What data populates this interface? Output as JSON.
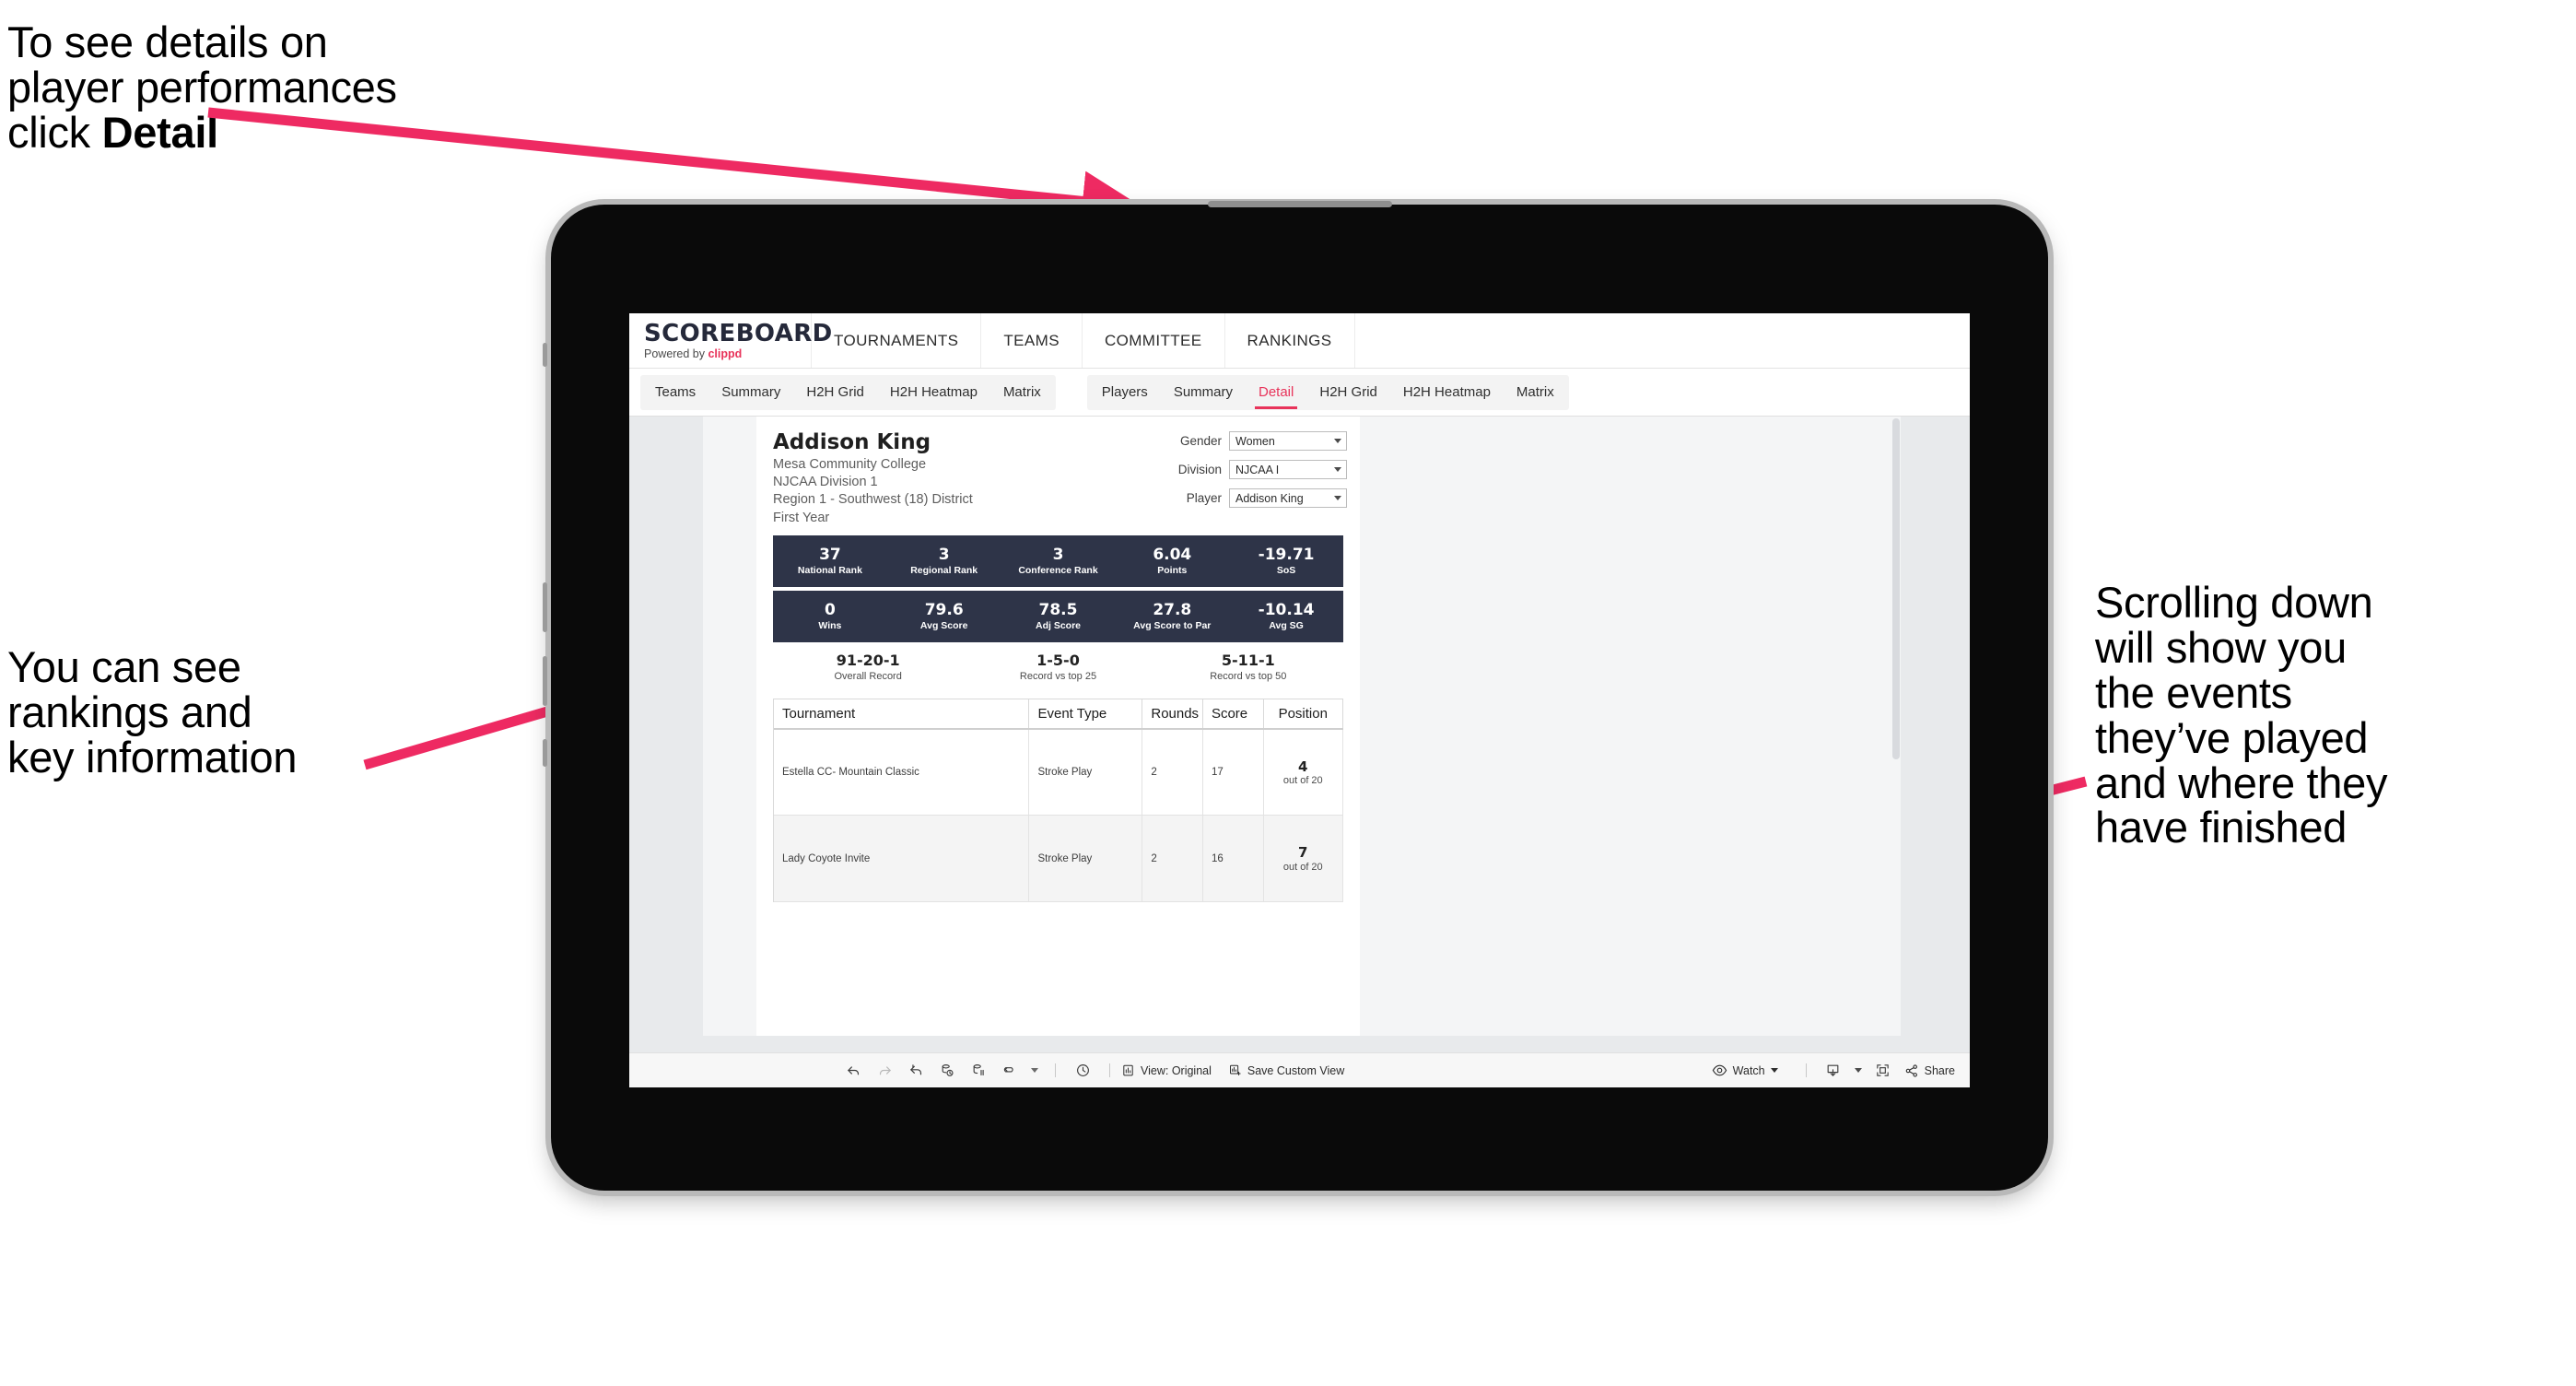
{
  "annotations": {
    "top_left": "To see details on\nplayer performances\nclick ",
    "top_left_bold": "Detail",
    "mid_left": "You can see\nrankings and\nkey information",
    "right": "Scrolling down\nwill show you\nthe events\nthey’ve played\nand where they\nhave finished",
    "arrow_color": "#ee2a62"
  },
  "app": {
    "logo": {
      "main": "SCOREBOARD",
      "powered_prefix": "Powered by ",
      "brand": "clippd"
    },
    "topnav": [
      "TOURNAMENTS",
      "TEAMS",
      "COMMITTEE",
      "RANKINGS"
    ],
    "tabs_group_1": [
      {
        "label": "Teams",
        "active": false
      },
      {
        "label": "Summary",
        "active": false
      },
      {
        "label": "H2H Grid",
        "active": false
      },
      {
        "label": "H2H Heatmap",
        "active": false
      },
      {
        "label": "Matrix",
        "active": false
      }
    ],
    "tabs_group_2": [
      {
        "label": "Players",
        "active": false
      },
      {
        "label": "Summary",
        "active": false
      },
      {
        "label": "Detail",
        "active": true
      },
      {
        "label": "H2H Grid",
        "active": false
      },
      {
        "label": "H2H Heatmap",
        "active": false
      },
      {
        "label": "Matrix",
        "active": false
      }
    ],
    "accent_color": "#e8335a",
    "kpi_bar_color": "#2e3448"
  },
  "player": {
    "name": "Addison King",
    "school": "Mesa Community College",
    "division": "NJCAA Division 1",
    "region": "Region 1 - Southwest (18) District",
    "year": "First Year"
  },
  "filters": [
    {
      "label": "Gender",
      "value": "Women"
    },
    {
      "label": "Division",
      "value": "NJCAA I"
    },
    {
      "label": "Player",
      "value": "Addison King"
    }
  ],
  "kpis_row1": [
    {
      "value": "37",
      "label": "National Rank"
    },
    {
      "value": "3",
      "label": "Regional Rank"
    },
    {
      "value": "3",
      "label": "Conference Rank"
    },
    {
      "value": "6.04",
      "label": "Points"
    },
    {
      "value": "-19.71",
      "label": "SoS"
    }
  ],
  "kpis_row2": [
    {
      "value": "0",
      "label": "Wins"
    },
    {
      "value": "79.6",
      "label": "Avg Score"
    },
    {
      "value": "78.5",
      "label": "Adj Score"
    },
    {
      "value": "27.8",
      "label": "Avg Score to Par"
    },
    {
      "value": "-10.14",
      "label": "Avg SG"
    }
  ],
  "records": [
    {
      "value": "91-20-1",
      "label": "Overall Record"
    },
    {
      "value": "1-5-0",
      "label": "Record vs top 25"
    },
    {
      "value": "5-11-1",
      "label": "Record vs top 50"
    }
  ],
  "tournament_table": {
    "headers": [
      "Tournament",
      "Event Type",
      "Rounds",
      "Score",
      "Position"
    ],
    "rows": [
      {
        "tournament": "Estella CC- Mountain Classic",
        "event_type": "Stroke Play",
        "rounds": "2",
        "score": "17",
        "position": "4",
        "position_sub": "out of 20"
      },
      {
        "tournament": "Lady Coyote Invite",
        "event_type": "Stroke Play",
        "rounds": "2",
        "score": "16",
        "position": "7",
        "position_sub": "out of 20"
      }
    ]
  },
  "toolbar": {
    "icons": [
      "undo-icon",
      "redo-icon",
      "revert-icon",
      "refresh-data-icon",
      "pause-updates-icon",
      "pan-icon",
      "pan-dropdown-caret"
    ],
    "clock_icon": "clock-icon",
    "view_original": "View: Original",
    "save_custom_view": "Save Custom View",
    "watch": "Watch",
    "share": "Share",
    "download_icon": "download-icon",
    "fullscreen_icon": "fullscreen-icon"
  }
}
